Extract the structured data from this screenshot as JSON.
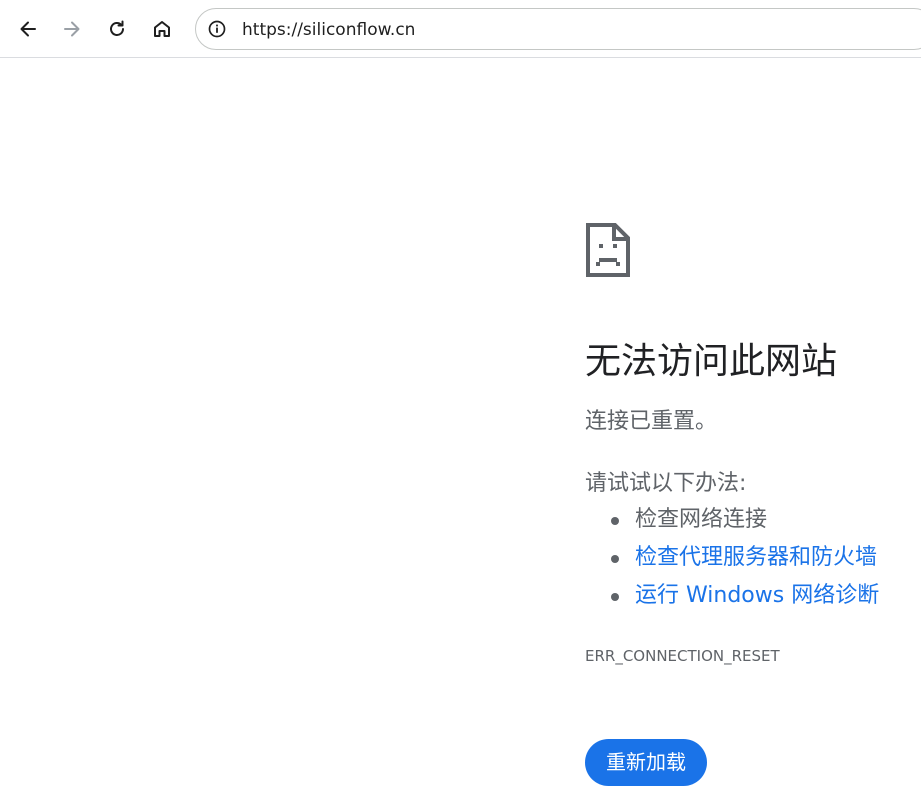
{
  "browser": {
    "url": "https://siliconflow.cn",
    "icons": {
      "back": "arrow-left-icon",
      "forward": "arrow-right-icon",
      "reload": "reload-icon",
      "home": "home-icon",
      "site_info": "info-icon"
    }
  },
  "error_page": {
    "icon": "sad-document-icon",
    "title": "无法访问此网站",
    "subtitle": "连接已重置。",
    "try_label": "请试试以下办法:",
    "suggestions": [
      {
        "label": "检查网络连接",
        "is_link": false
      },
      {
        "label": "检查代理服务器和防火墙",
        "is_link": true
      },
      {
        "label": "运行 Windows 网络诊断",
        "is_link": true
      }
    ],
    "error_code": "ERR_CONNECTION_RESET",
    "reload_label": "重新加载"
  },
  "colors": {
    "link": "#1a73e8",
    "button_bg": "#1a73e8",
    "text_secondary": "#5f6368",
    "text_primary": "#202124"
  }
}
